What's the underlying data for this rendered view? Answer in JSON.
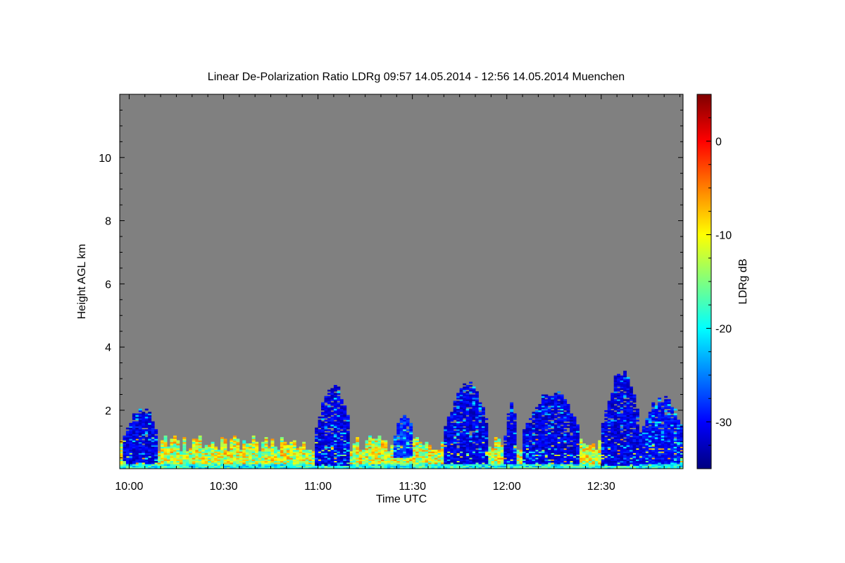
{
  "chart_data": {
    "type": "heatmap",
    "title": "Linear De-Polarization Ratio LDRg   09:57 14.05.2014 - 12:56 14.05.2014 Muenchen",
    "xlabel": "Time UTC",
    "ylabel": "Height AGL km",
    "colorbar_label": "LDRg dB",
    "x_range": [
      "09:57",
      "12:56"
    ],
    "xlim_minutes": [
      597,
      776
    ],
    "ylim": [
      0.15,
      12
    ],
    "x_ticks": [
      {
        "label": "10:00",
        "minutes": 600
      },
      {
        "label": "10:30",
        "minutes": 630
      },
      {
        "label": "11:00",
        "minutes": 660
      },
      {
        "label": "11:30",
        "minutes": 690
      },
      {
        "label": "12:00",
        "minutes": 720
      },
      {
        "label": "12:30",
        "minutes": 750
      }
    ],
    "y_ticks": [
      {
        "label": "2",
        "value": 2
      },
      {
        "label": "4",
        "value": 4
      },
      {
        "label": "6",
        "value": 6
      },
      {
        "label": "8",
        "value": 8
      },
      {
        "label": "10",
        "value": 10
      }
    ],
    "colorbar_range": [
      -35,
      5
    ],
    "colorbar_ticks": [
      {
        "label": "0",
        "value": 0
      },
      {
        "label": "-10",
        "value": -10
      },
      {
        "label": "-20",
        "value": -20
      },
      {
        "label": "-30",
        "value": -30
      }
    ],
    "background_color": "#808080",
    "colormap": "jet",
    "features": [
      {
        "kind": "surface_layer",
        "t0": 597,
        "t1": 776,
        "z0": 0.15,
        "z1": 1.2,
        "ldr": -12
      },
      {
        "kind": "cloud",
        "t0": 598,
        "t1": 609,
        "z0": 0.3,
        "z1": 2.2,
        "ldr": -31
      },
      {
        "kind": "cloud",
        "t0": 659,
        "t1": 670,
        "z0": 0.25,
        "z1": 2.9,
        "ldr": -31
      },
      {
        "kind": "cloud",
        "t0": 684,
        "t1": 690,
        "z0": 0.5,
        "z1": 2.0,
        "ldr": -28
      },
      {
        "kind": "cloud",
        "t0": 700,
        "t1": 714,
        "z0": 0.3,
        "z1": 2.9,
        "ldr": -31
      },
      {
        "kind": "cloud",
        "t0": 719,
        "t1": 723,
        "z0": 0.3,
        "z1": 2.3,
        "ldr": -31
      },
      {
        "kind": "cloud",
        "t0": 725,
        "t1": 743,
        "z0": 0.3,
        "z1": 2.7,
        "ldr": -31
      },
      {
        "kind": "cloud",
        "t0": 750,
        "t1": 762,
        "z0": 0.25,
        "z1": 3.3,
        "ldr": -31
      },
      {
        "kind": "cloud",
        "t0": 762,
        "t1": 776,
        "z0": 0.3,
        "z1": 2.5,
        "ldr": -30
      }
    ]
  }
}
